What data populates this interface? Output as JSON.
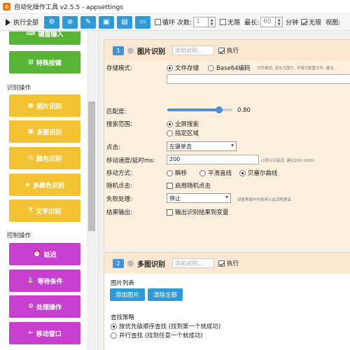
{
  "window": {
    "title": "自动化操作工具 v2.5.5 - appsettings",
    "icon": "app-icon"
  },
  "toolbar": {
    "run_all": "执行全部",
    "icons": [
      "gear-icon",
      "folder-add-icon",
      "broom-icon",
      "save-icon",
      "save-as-icon",
      "folder-open-icon"
    ],
    "loop_label": "循环",
    "count_label": "次数:",
    "count_value": "1",
    "infinite_label": "无限",
    "max_label": "最长:",
    "max_value": "60",
    "minutes_label": "分钟",
    "infinite2_label": "无限",
    "view_label": "视图:"
  },
  "sidebar": {
    "top_buttons": [
      {
        "label": "键盘输入",
        "icon": "keyboard-icon"
      },
      {
        "label": "特殊按键",
        "icon": "keypad-icon"
      }
    ],
    "group1": "识别操作",
    "recognize_buttons": [
      {
        "label": "图片识别",
        "icon": "image-icon"
      },
      {
        "label": "多图识别",
        "icon": "images-icon"
      },
      {
        "label": "颜色识别",
        "icon": "palette-icon"
      },
      {
        "label": "多颜色识别",
        "icon": "multi-color-icon"
      },
      {
        "label": "文字识别",
        "icon": "text-icon"
      }
    ],
    "group2": "控制操作",
    "control_buttons": [
      {
        "label": "延迟",
        "icon": "alarm-icon"
      },
      {
        "label": "等待条件",
        "icon": "hourglass-icon"
      },
      {
        "label": "处理操作",
        "icon": "gear-icon"
      },
      {
        "label": "移动窗口",
        "icon": "arrow-left-icon"
      }
    ]
  },
  "card1": {
    "number": "1",
    "title": "图片识别",
    "note_placeholder": "添加说明...",
    "execute_label": "执行",
    "storage_label": "存储模式:",
    "storage_file": "文件存储",
    "storage_b64": "Base64编码",
    "storage_hint": "文件模式: 适合大图片, 不增大配置文件, 建议...",
    "similarity_label": "匹配度:",
    "similarity_value": "0.80",
    "similarity_fraction": 0.8,
    "scope_label": "搜索范围:",
    "scope_full": "全屏搜索",
    "scope_area": "指定区域",
    "click_label": "点击:",
    "click_value": "左键单击",
    "speed_label": "移动速度/延时ms:",
    "speed_value": "200",
    "speed_hint": "(0表示无延迟, 建议200-1000)",
    "move_label": "移动方式:",
    "move_instant": "瞬移",
    "move_smooth": "平滑直线",
    "move_bezier": "贝塞尔曲线",
    "random_label": "随机点击:",
    "random_option": "启用随机点击",
    "fail_label": "失败处理:",
    "fail_value": "停止",
    "fail_hint": "设置界面中失败停止此流程更高",
    "output_label": "结果输出:",
    "output_option": "输出识别结果到变量"
  },
  "card2": {
    "number": "2",
    "title": "多图识别",
    "note_placeholder": "添加说明...",
    "execute_label": "执行",
    "list_label": "图片列表",
    "add_image": "添加图片",
    "clear_all": "清除全部",
    "strategy_label": "查找策略",
    "strategy_priority": "按优先级顺序查找 (找到第一个就成功)",
    "strategy_parallel": "并行查找 (找到任意一个就成功)"
  }
}
